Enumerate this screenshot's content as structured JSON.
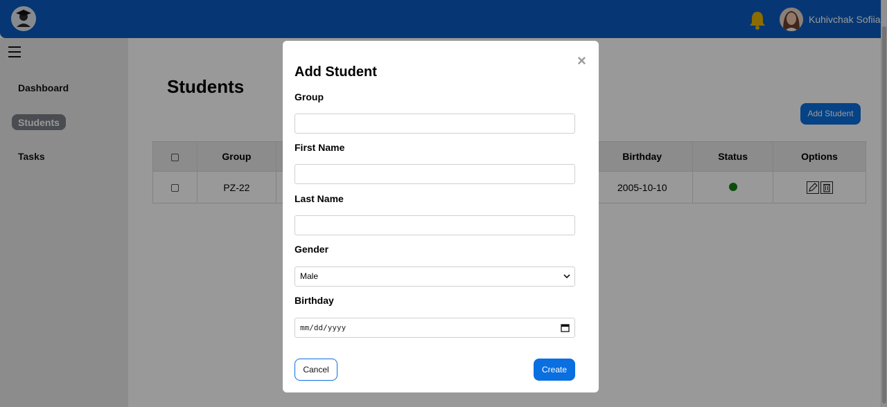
{
  "header": {
    "username": "Kuhivchak Sofiia",
    "colors": {
      "header_bg": "#0a5dc2",
      "bell": "#e8b400"
    },
    "icons": {
      "logo": "graduate-logo-icon",
      "bell": "bell-icon",
      "avatar": "user-avatar"
    }
  },
  "sidebar": {
    "menu_icon": "hamburger-menu-icon",
    "items": [
      {
        "label": "Dashboard",
        "active": false
      },
      {
        "label": "Students",
        "active": true
      },
      {
        "label": "Tasks",
        "active": false
      }
    ]
  },
  "main": {
    "title": "Students",
    "add_button_label": "Add Student",
    "table": {
      "headers": [
        "",
        "Group",
        "",
        "",
        "Birthday",
        "Status",
        "Options"
      ],
      "rows": [
        {
          "group": "PZ-22",
          "birthday": "2005-10-10",
          "status_color": "#148014",
          "option_icons": [
            "edit-icon",
            "trash-icon"
          ]
        }
      ]
    }
  },
  "modal": {
    "title": "Add Student",
    "close_label": "×",
    "fields": {
      "group": {
        "label": "Group",
        "value": ""
      },
      "first_name": {
        "label": "First Name",
        "value": ""
      },
      "last_name": {
        "label": "Last Name",
        "value": ""
      },
      "gender": {
        "label": "Gender",
        "value": "Male"
      },
      "birthday": {
        "label": "Birthday",
        "placeholder": "mm/dd/yyyy"
      }
    },
    "cancel_label": "Cancel",
    "create_label": "Create",
    "colors": {
      "primary": "#0a6fe0"
    }
  }
}
